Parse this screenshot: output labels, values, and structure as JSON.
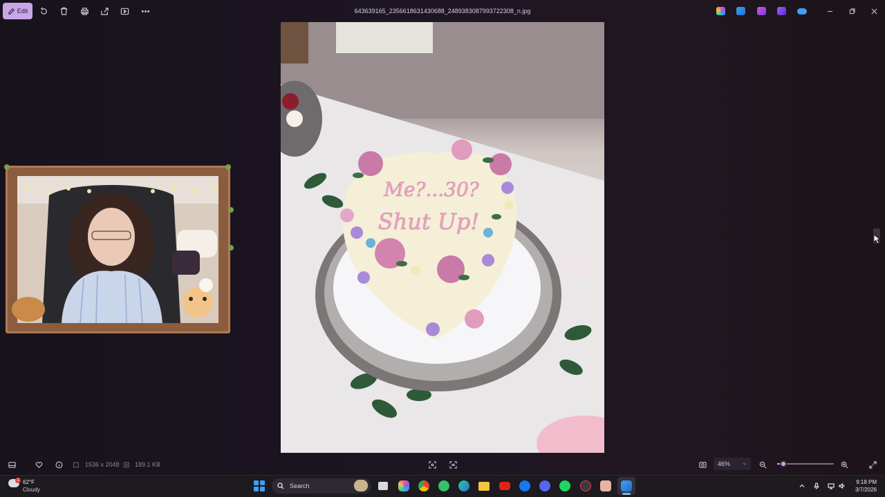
{
  "toolbar": {
    "edit_label": "Edit",
    "file_name": "643639165_2356618631430688_2489383087993722308_n.jpg"
  },
  "status": {
    "dimensions": "1536 x 2048",
    "file_size": "189.1 KB",
    "zoom": "46%",
    "zoom_level": 0.05
  },
  "cake": {
    "line1": "Me?...30?",
    "line2": "Shut Up!"
  },
  "taskbar": {
    "weather_temp": "62°F",
    "weather_desc": "Cloudy",
    "weather_badge": "1",
    "search_label": "Search",
    "time": "9:18 PM",
    "date": "3/7/2026"
  },
  "colors": {
    "accent": "#c9a6e8",
    "windows_blue": "#3ea0f0"
  }
}
